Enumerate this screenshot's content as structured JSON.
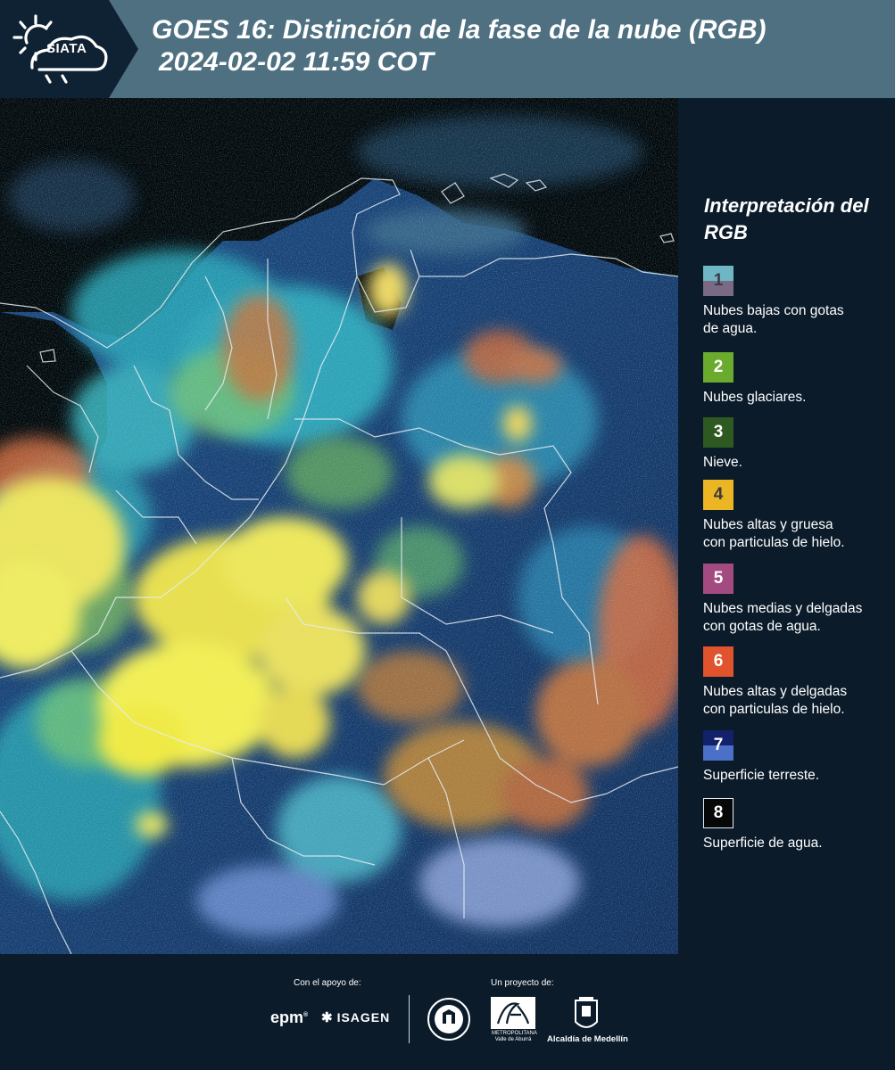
{
  "header": {
    "logo_text": "SIATA",
    "title_line1": "GOES 16: Distinción de la fase de la nube (RGB)",
    "title_line2": "2024-02-02 11:59 COT"
  },
  "legend": {
    "title": "Interpretación del RGB",
    "items": [
      {
        "num": "1",
        "desc1": "Nubes bajas con gotas",
        "desc2": "de agua.",
        "color_top": "#6fb7c4",
        "color_bottom": "#7b6a86",
        "num_color": "#3a3a4a"
      },
      {
        "num": "2",
        "desc1": "Nubes glaciares.",
        "desc2": "",
        "color_top": "#6aab2e",
        "color_bottom": "#6aab2e",
        "num_color": "#ffffff"
      },
      {
        "num": "3",
        "desc1": "Nieve.",
        "desc2": "",
        "color_top": "#2e5a22",
        "color_bottom": "#2e5a22",
        "num_color": "#ffffff"
      },
      {
        "num": "4",
        "desc1": "Nubes altas y gruesa",
        "desc2": "con particulas de hielo.",
        "color_top": "#ebb524",
        "color_bottom": "#ebb524",
        "num_color": "#3a3a3a"
      },
      {
        "num": "5",
        "desc1": "Nubes medias y delgadas",
        "desc2": "con gotas de agua.",
        "color_top": "#a34b80",
        "color_bottom": "#a34b80",
        "num_color": "#ffffff"
      },
      {
        "num": "6",
        "desc1": "Nubes altas y delgadas",
        "desc2": "con particulas de hielo.",
        "color_top": "#e0532c",
        "color_bottom": "#e0532c",
        "num_color": "#ffffff"
      },
      {
        "num": "7",
        "desc1": "Superficie terreste.",
        "desc2": "",
        "color_top": "#12216a",
        "color_bottom": "#4b70c8",
        "num_color": "#ffffff"
      },
      {
        "num": "8",
        "desc1": "Superficie de agua.",
        "desc2": "",
        "color_top": "#050806",
        "color_bottom": "#050806",
        "num_color": "#ffffff"
      }
    ]
  },
  "footer": {
    "support_label": "Con el apoyo de:",
    "project_label": "Un proyecto de:",
    "epm": "epm",
    "isagen": "ISAGEN",
    "area_text": "METROPOLITANA Valle de Aburrá",
    "alcaldia": "Alcaldía de Medellín"
  }
}
